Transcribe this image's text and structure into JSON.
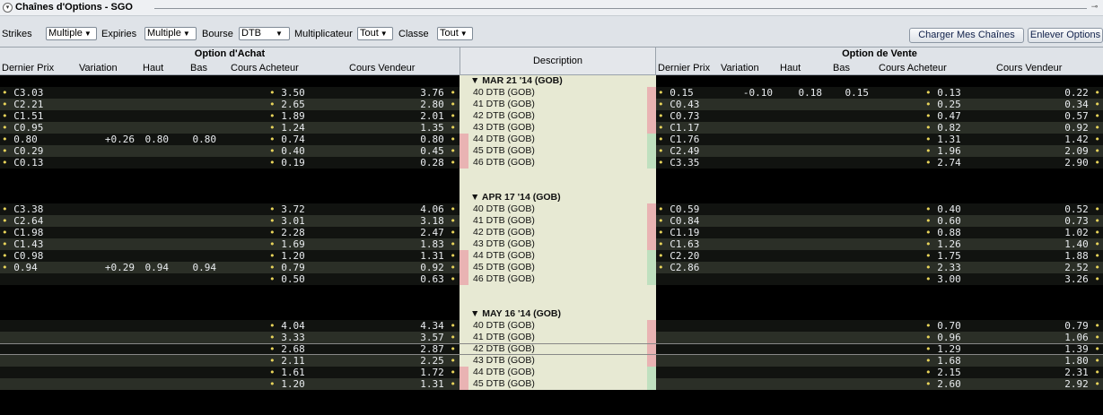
{
  "window": {
    "title": "Chaînes d'Options - SGO",
    "collapse_icon": "circle-chevron-icon",
    "pin_icon": "pin-icon"
  },
  "toolbar": {
    "strikes_label": "Strikes",
    "strikes_value": "Multiple",
    "expiries_label": "Expiries",
    "expiries_value": "Multiple",
    "bourse_label": "Bourse",
    "bourse_value": "DTB",
    "multiplicateur_label": "Multiplicateur",
    "multiplicateur_value": "Tout",
    "classe_label": "Classe",
    "classe_value": "Tout",
    "charger_button": "Charger Mes Chaînes",
    "enlever_button": "Enlever Options"
  },
  "headers": {
    "call_group": "Option d'Achat",
    "put_group": "Option de Vente",
    "description": "Description",
    "columns": [
      "Dernier Prix",
      "Variation",
      "Haut",
      "Bas",
      "Cours Acheteur",
      "Cours Vendeur"
    ]
  },
  "groups": [
    {
      "label": "MAR 21 '14 (GOB)",
      "rows": [
        {
          "desc": "40 DTB (GOB)",
          "strip": "pink",
          "call": {
            "last": "C3.03",
            "chg": "",
            "high": "",
            "low": "",
            "bid": "3.50",
            "ask": "3.76"
          },
          "put": {
            "last": "0.15",
            "chg": "-0.10",
            "high": "0.18",
            "low": "0.15",
            "bid": "0.13",
            "ask": "0.22"
          }
        },
        {
          "desc": "41 DTB (GOB)",
          "strip": "pink",
          "call": {
            "last": "C2.21",
            "chg": "",
            "high": "",
            "low": "",
            "bid": "2.65",
            "ask": "2.80"
          },
          "put": {
            "last": "C0.43",
            "chg": "",
            "high": "",
            "low": "",
            "bid": "0.25",
            "ask": "0.34"
          }
        },
        {
          "desc": "42 DTB (GOB)",
          "strip": "pink",
          "call": {
            "last": "C1.51",
            "chg": "",
            "high": "",
            "low": "",
            "bid": "1.89",
            "ask": "2.01"
          },
          "put": {
            "last": "C0.73",
            "chg": "",
            "high": "",
            "low": "",
            "bid": "0.47",
            "ask": "0.57"
          }
        },
        {
          "desc": "43 DTB (GOB)",
          "strip": "pink",
          "call": {
            "last": "C0.95",
            "chg": "",
            "high": "",
            "low": "",
            "bid": "1.24",
            "ask": "1.35"
          },
          "put": {
            "last": "C1.17",
            "chg": "",
            "high": "",
            "low": "",
            "bid": "0.82",
            "ask": "0.92"
          }
        },
        {
          "desc": "44 DTB (GOB)",
          "strip": "green",
          "call": {
            "last": "0.80",
            "chg": "+0.26",
            "high": "0.80",
            "low": "0.80",
            "bid": "0.74",
            "ask": "0.80"
          },
          "put": {
            "last": "C1.76",
            "chg": "",
            "high": "",
            "low": "",
            "bid": "1.31",
            "ask": "1.42"
          }
        },
        {
          "desc": "45 DTB (GOB)",
          "strip": "green",
          "call": {
            "last": "C0.29",
            "chg": "",
            "high": "",
            "low": "",
            "bid": "0.40",
            "ask": "0.45"
          },
          "put": {
            "last": "C2.49",
            "chg": "",
            "high": "",
            "low": "",
            "bid": "1.96",
            "ask": "2.09"
          }
        },
        {
          "desc": "46 DTB (GOB)",
          "strip": "green",
          "call": {
            "last": "C0.13",
            "chg": "",
            "high": "",
            "low": "",
            "bid": "0.19",
            "ask": "0.28"
          },
          "put": {
            "last": "C3.35",
            "chg": "",
            "high": "",
            "low": "",
            "bid": "2.74",
            "ask": "2.90"
          }
        }
      ]
    },
    {
      "label": "APR 17 '14 (GOB)",
      "rows": [
        {
          "desc": "40 DTB (GOB)",
          "strip": "pink",
          "call": {
            "last": "C3.38",
            "chg": "",
            "high": "",
            "low": "",
            "bid": "3.72",
            "ask": "4.06"
          },
          "put": {
            "last": "C0.59",
            "chg": "",
            "high": "",
            "low": "",
            "bid": "0.40",
            "ask": "0.52"
          }
        },
        {
          "desc": "41 DTB (GOB)",
          "strip": "pink",
          "call": {
            "last": "C2.64",
            "chg": "",
            "high": "",
            "low": "",
            "bid": "3.01",
            "ask": "3.18"
          },
          "put": {
            "last": "C0.84",
            "chg": "",
            "high": "",
            "low": "",
            "bid": "0.60",
            "ask": "0.73"
          }
        },
        {
          "desc": "42 DTB (GOB)",
          "strip": "pink",
          "call": {
            "last": "C1.98",
            "chg": "",
            "high": "",
            "low": "",
            "bid": "2.28",
            "ask": "2.47"
          },
          "put": {
            "last": "C1.19",
            "chg": "",
            "high": "",
            "low": "",
            "bid": "0.88",
            "ask": "1.02"
          }
        },
        {
          "desc": "43 DTB (GOB)",
          "strip": "pink",
          "call": {
            "last": "C1.43",
            "chg": "",
            "high": "",
            "low": "",
            "bid": "1.69",
            "ask": "1.83"
          },
          "put": {
            "last": "C1.63",
            "chg": "",
            "high": "",
            "low": "",
            "bid": "1.26",
            "ask": "1.40"
          }
        },
        {
          "desc": "44 DTB (GOB)",
          "strip": "green",
          "call": {
            "last": "C0.98",
            "chg": "",
            "high": "",
            "low": "",
            "bid": "1.20",
            "ask": "1.31"
          },
          "put": {
            "last": "C2.20",
            "chg": "",
            "high": "",
            "low": "",
            "bid": "1.75",
            "ask": "1.88"
          }
        },
        {
          "desc": "45 DTB (GOB)",
          "strip": "green",
          "call": {
            "last": "0.94",
            "chg": "+0.29",
            "high": "0.94",
            "low": "0.94",
            "bid": "0.79",
            "ask": "0.92"
          },
          "put": {
            "last": "C2.86",
            "chg": "",
            "high": "",
            "low": "",
            "bid": "2.33",
            "ask": "2.52"
          }
        },
        {
          "desc": "46 DTB (GOB)",
          "strip": "green",
          "call": {
            "last": "",
            "chg": "",
            "high": "",
            "low": "",
            "bid": "0.50",
            "ask": "0.63"
          },
          "put": {
            "last": "",
            "chg": "",
            "high": "",
            "low": "",
            "bid": "3.00",
            "ask": "3.26"
          }
        }
      ]
    },
    {
      "label": "MAY 16 '14 (GOB)",
      "rows": [
        {
          "desc": "40 DTB (GOB)",
          "strip": "pink",
          "call": {
            "last": "",
            "chg": "",
            "high": "",
            "low": "",
            "bid": "4.04",
            "ask": "4.34"
          },
          "put": {
            "last": "",
            "chg": "",
            "high": "",
            "low": "",
            "bid": "0.70",
            "ask": "0.79"
          }
        },
        {
          "desc": "41 DTB (GOB)",
          "strip": "pink",
          "call": {
            "last": "",
            "chg": "",
            "high": "",
            "low": "",
            "bid": "3.33",
            "ask": "3.57"
          },
          "put": {
            "last": "",
            "chg": "",
            "high": "",
            "low": "",
            "bid": "0.96",
            "ask": "1.06"
          }
        },
        {
          "desc": "42 DTB (GOB)",
          "strip": "pink",
          "call": {
            "last": "",
            "chg": "",
            "high": "",
            "low": "",
            "bid": "2.68",
            "ask": "2.87"
          },
          "put": {
            "last": "",
            "chg": "",
            "high": "",
            "low": "",
            "bid": "1.29",
            "ask": "1.39"
          }
        },
        {
          "desc": "43 DTB (GOB)",
          "strip": "pink",
          "call": {
            "last": "",
            "chg": "",
            "high": "",
            "low": "",
            "bid": "2.11",
            "ask": "2.25"
          },
          "put": {
            "last": "",
            "chg": "",
            "high": "",
            "low": "",
            "bid": "1.68",
            "ask": "1.80"
          }
        },
        {
          "desc": "44 DTB (GOB)",
          "strip": "green",
          "call": {
            "last": "",
            "chg": "",
            "high": "",
            "low": "",
            "bid": "1.61",
            "ask": "1.72"
          },
          "put": {
            "last": "",
            "chg": "",
            "high": "",
            "low": "",
            "bid": "2.15",
            "ask": "2.31"
          }
        },
        {
          "desc": "45 DTB (GOB)",
          "strip": "green",
          "call": {
            "last": "",
            "chg": "",
            "high": "",
            "low": "",
            "bid": "1.20",
            "ask": "1.31"
          },
          "put": {
            "last": "",
            "chg": "",
            "high": "",
            "low": "",
            "bid": "2.60",
            "ask": "2.92"
          }
        }
      ]
    }
  ],
  "colors": {
    "positive": "#e9ecef",
    "bullet": "#e8d45a",
    "itm_strip": "#e9b3b3",
    "otm_strip": "#bfe0bf",
    "desc_bg": "#e7e9d3"
  }
}
